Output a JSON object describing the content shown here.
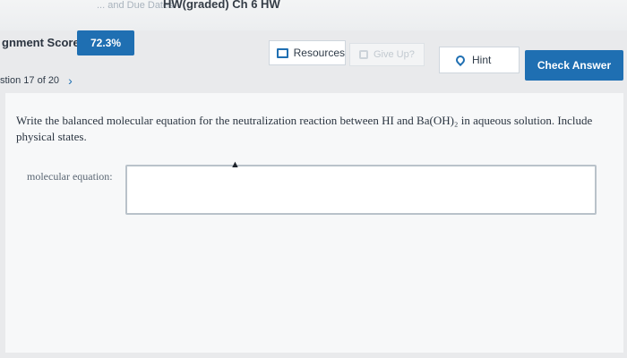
{
  "header": {
    "crumb_faded": "... and Due Dates",
    "crumb_current": "HW(graded) Ch 6 HW"
  },
  "score": {
    "label": "gnment Score:",
    "value": "72.3%"
  },
  "toolbar": {
    "resources_label": "Resources",
    "giveup_label": "Give Up?",
    "hint_label": "Hint",
    "check_label": "Check Answer"
  },
  "question_nav": {
    "label": "stion 17 of 20",
    "next_icon": "chevron-right-icon"
  },
  "question": {
    "prompt_text": "Write the balanced molecular equation for the neutralization reaction between HI and Ba(OH)₂ in aqueous solution. Include physical states.",
    "input_label": "molecular equation:",
    "input_value": ""
  },
  "colors": {
    "accent": "#1f6fb2",
    "background": "#e9eaec"
  },
  "icons": {
    "resources": "resources-box-icon",
    "giveup": "giveup-flag-icon",
    "hint": "hint-pin-icon"
  }
}
